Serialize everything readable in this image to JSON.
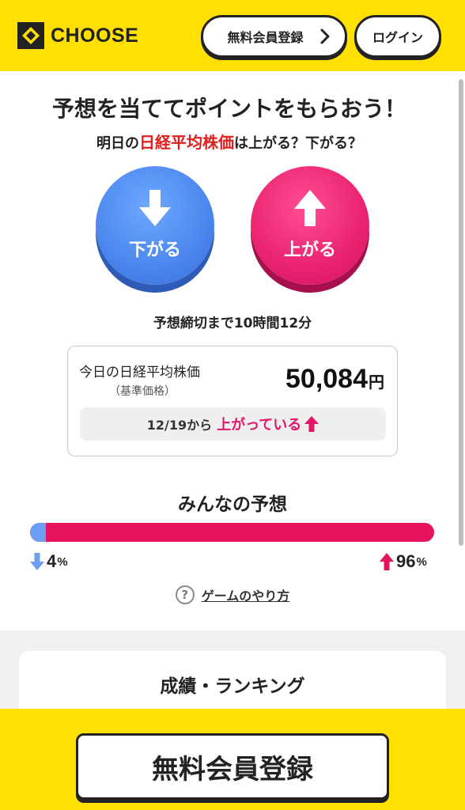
{
  "header": {
    "logo_text": "CHOOSE",
    "register_label": "無料会員登録",
    "login_label": "ログイン"
  },
  "game": {
    "headline": "予想を当ててポイントをもらおう！",
    "subline_prefix": "明日の",
    "subline_accent": "日経平均株価",
    "subline_suffix": "は上がる？下がる？",
    "down_label": "下がる",
    "up_label": "上がる",
    "deadline": "予想締切まで10時間12分"
  },
  "price": {
    "label": "今日の日経平均株価",
    "sub_label": "（基準価格）",
    "value": "50,084",
    "unit": "円",
    "change_prefix": "12/19から",
    "change_status": "上がっている"
  },
  "poll": {
    "title": "みんなの予想",
    "down_percent": 4,
    "up_percent": 96,
    "down_value": "4",
    "up_value": "96",
    "percent_unit": "%"
  },
  "howto": {
    "icon": "?",
    "label": "ゲームのやり方"
  },
  "ranking": {
    "title": "成績・ランキング"
  },
  "footer": {
    "register_label": "無料会員登録"
  },
  "colors": {
    "brand_yellow": "#ffe000",
    "down_blue": "#4a86ee",
    "up_pink": "#ea2271",
    "accent_red": "#e0201f"
  }
}
